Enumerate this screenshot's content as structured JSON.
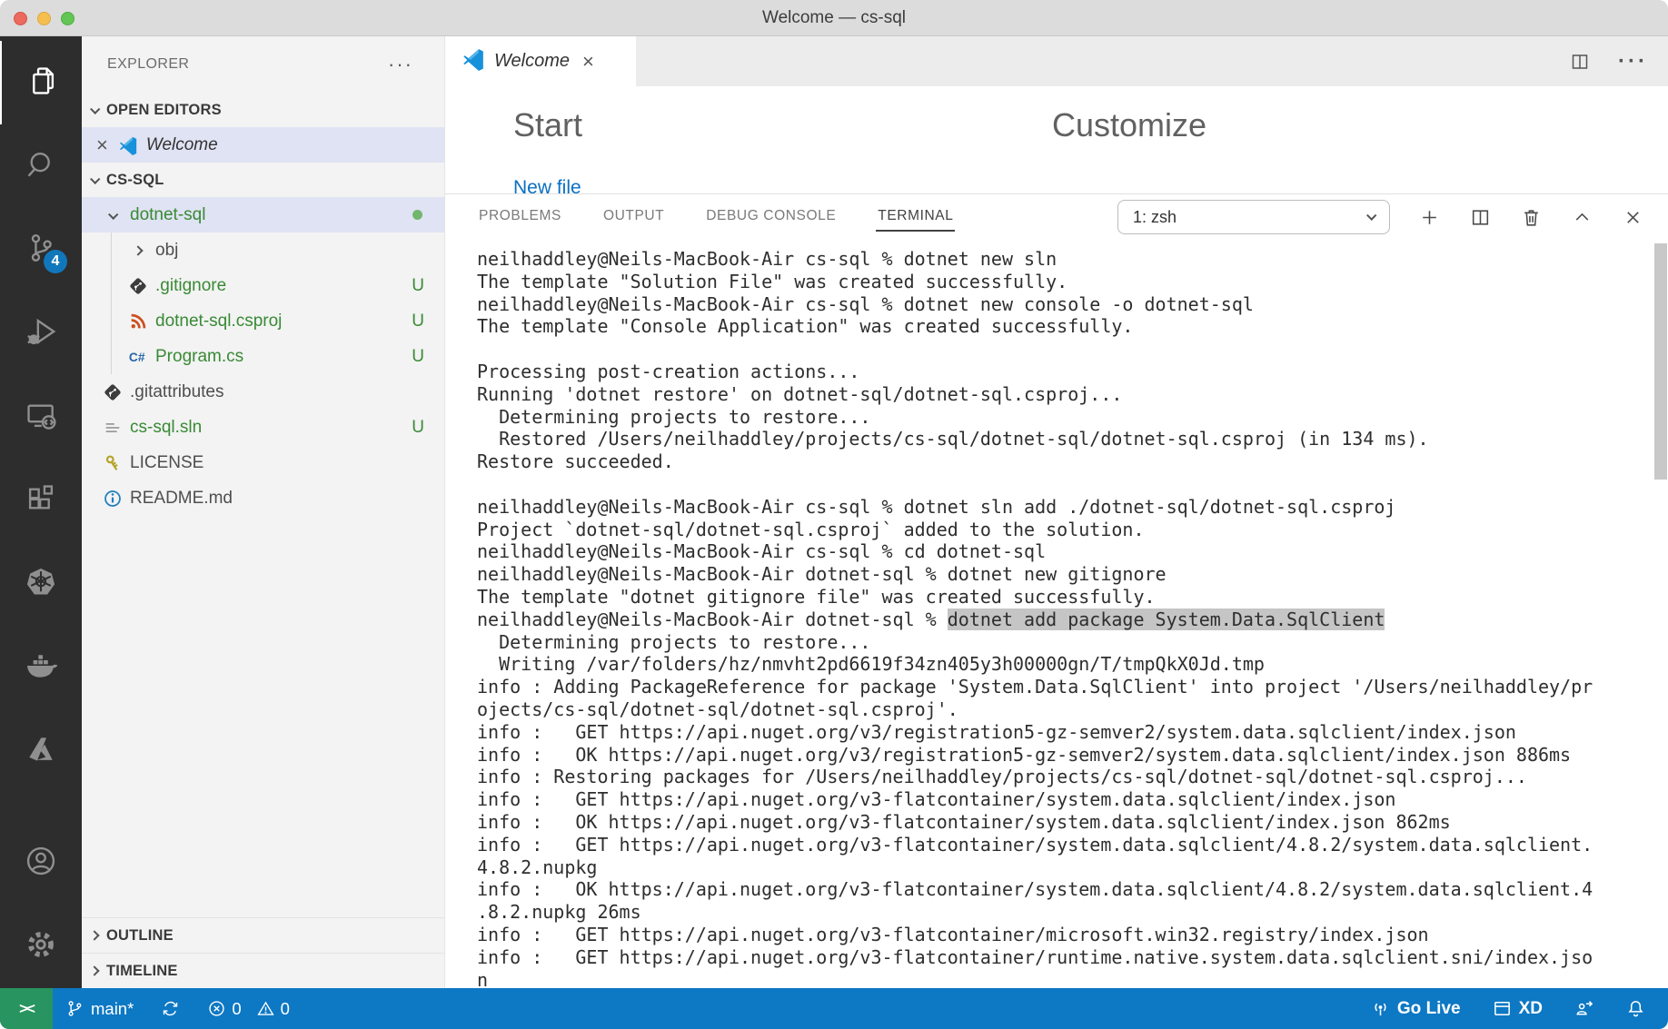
{
  "window": {
    "title": "Welcome — cs-sql"
  },
  "colors": {
    "accent": "#0d78c4",
    "remote-green": "#28945f",
    "green": "#388a34",
    "badge": "#1177bb",
    "sel": "#c5c5c5"
  },
  "activity_bar": {
    "items": [
      {
        "name": "explorer",
        "icon": "files-icon",
        "active": true
      },
      {
        "name": "search",
        "icon": "search-icon"
      },
      {
        "name": "source-control",
        "icon": "source-control-icon",
        "badge": "4"
      },
      {
        "name": "run-debug",
        "icon": "debug-icon"
      },
      {
        "name": "remote-explorer",
        "icon": "remote-icon"
      },
      {
        "name": "extensions",
        "icon": "extensions-icon"
      },
      {
        "name": "kubernetes",
        "icon": "kubernetes-icon"
      },
      {
        "name": "docker",
        "icon": "docker-icon"
      },
      {
        "name": "azure",
        "icon": "azure-icon"
      }
    ],
    "bottom_items": [
      {
        "name": "accounts",
        "icon": "accounts-icon"
      },
      {
        "name": "settings",
        "icon": "gear-icon"
      }
    ]
  },
  "sidebar": {
    "title": "EXPLORER",
    "more_label": "···",
    "sections": {
      "open_editors": "OPEN EDITORS",
      "project": "CS-SQL",
      "outline": "OUTLINE",
      "timeline": "TIMELINE"
    },
    "open_editors": [
      {
        "label": "Welcome",
        "icon": "vscode-icon",
        "selected": true,
        "close": "×"
      }
    ],
    "tree": [
      {
        "label": "dotnet-sql",
        "indent": 0,
        "chevron": "down",
        "color": "green",
        "dot": true,
        "selected": true
      },
      {
        "label": "obj",
        "indent": 1,
        "chevron": "right",
        "color": "gray",
        "guide": true
      },
      {
        "label": ".gitignore",
        "indent": 1,
        "icon": "git-icon",
        "color": "green",
        "badge": "U",
        "guide": true
      },
      {
        "label": "dotnet-sql.csproj",
        "indent": 1,
        "icon": "csproj-icon",
        "color": "green",
        "badge": "U",
        "guide": true
      },
      {
        "label": "Program.cs",
        "indent": 1,
        "icon": "csharp-icon",
        "color": "green",
        "badge": "U",
        "guide": true
      },
      {
        "label": ".gitattributes",
        "indent": 0,
        "icon": "git-icon",
        "color": "gray"
      },
      {
        "label": "cs-sql.sln",
        "indent": 0,
        "icon": "sln-icon",
        "color": "green",
        "badge": "U"
      },
      {
        "label": "LICENSE",
        "indent": 0,
        "icon": "key-icon",
        "color": "gray"
      },
      {
        "label": "README.md",
        "indent": 0,
        "icon": "info-icon",
        "color": "gray"
      }
    ]
  },
  "editor": {
    "tab": {
      "label": "Welcome",
      "close": "×"
    },
    "start_heading": "Start",
    "customize_heading": "Customize",
    "new_file_link": "New file"
  },
  "panel": {
    "tabs": [
      {
        "label": "PROBLEMS"
      },
      {
        "label": "OUTPUT"
      },
      {
        "label": "DEBUG CONSOLE"
      },
      {
        "label": "TERMINAL",
        "active": true
      }
    ],
    "shell_select": "1: zsh",
    "terminal_lines": [
      "neilhaddley@Neils-MacBook-Air cs-sql % dotnet new sln",
      "The template \"Solution File\" was created successfully.",
      "neilhaddley@Neils-MacBook-Air cs-sql % dotnet new console -o dotnet-sql",
      "The template \"Console Application\" was created successfully.",
      "",
      "Processing post-creation actions...",
      "Running 'dotnet restore' on dotnet-sql/dotnet-sql.csproj...",
      "  Determining projects to restore...",
      "  Restored /Users/neilhaddley/projects/cs-sql/dotnet-sql/dotnet-sql.csproj (in 134 ms).",
      "Restore succeeded.",
      "",
      "neilhaddley@Neils-MacBook-Air cs-sql % dotnet sln add ./dotnet-sql/dotnet-sql.csproj",
      "Project `dotnet-sql/dotnet-sql.csproj` added to the solution.",
      "neilhaddley@Neils-MacBook-Air cs-sql % cd dotnet-sql",
      "neilhaddley@Neils-MacBook-Air dotnet-sql % dotnet new gitignore",
      "The template \"dotnet gitignore file\" was created successfully.",
      {
        "pre": "neilhaddley@Neils-MacBook-Air dotnet-sql % ",
        "highlight": "dotnet add package System.Data.SqlClient",
        "post": ""
      },
      "  Determining projects to restore...",
      "  Writing /var/folders/hz/nmvht2pd6619f34zn405y3h00000gn/T/tmpQkX0Jd.tmp",
      "info : Adding PackageReference for package 'System.Data.SqlClient' into project '/Users/neilhaddley/pr",
      "ojects/cs-sql/dotnet-sql/dotnet-sql.csproj'.",
      "info :   GET https://api.nuget.org/v3/registration5-gz-semver2/system.data.sqlclient/index.json",
      "info :   OK https://api.nuget.org/v3/registration5-gz-semver2/system.data.sqlclient/index.json 886ms",
      "info : Restoring packages for /Users/neilhaddley/projects/cs-sql/dotnet-sql/dotnet-sql.csproj...",
      "info :   GET https://api.nuget.org/v3-flatcontainer/system.data.sqlclient/index.json",
      "info :   OK https://api.nuget.org/v3-flatcontainer/system.data.sqlclient/index.json 862ms",
      "info :   GET https://api.nuget.org/v3-flatcontainer/system.data.sqlclient/4.8.2/system.data.sqlclient.",
      "4.8.2.nupkg",
      "info :   OK https://api.nuget.org/v3-flatcontainer/system.data.sqlclient/4.8.2/system.data.sqlclient.4",
      ".8.2.nupkg 26ms",
      "info :   GET https://api.nuget.org/v3-flatcontainer/microsoft.win32.registry/index.json",
      "info :   GET https://api.nuget.org/v3-flatcontainer/runtime.native.system.data.sqlclient.sni/index.jso",
      "n"
    ]
  },
  "status_bar": {
    "remote_glyph": "><",
    "branch": "main*",
    "errors": "0",
    "warnings": "0",
    "go_live": "Go Live",
    "xd": "XD"
  }
}
